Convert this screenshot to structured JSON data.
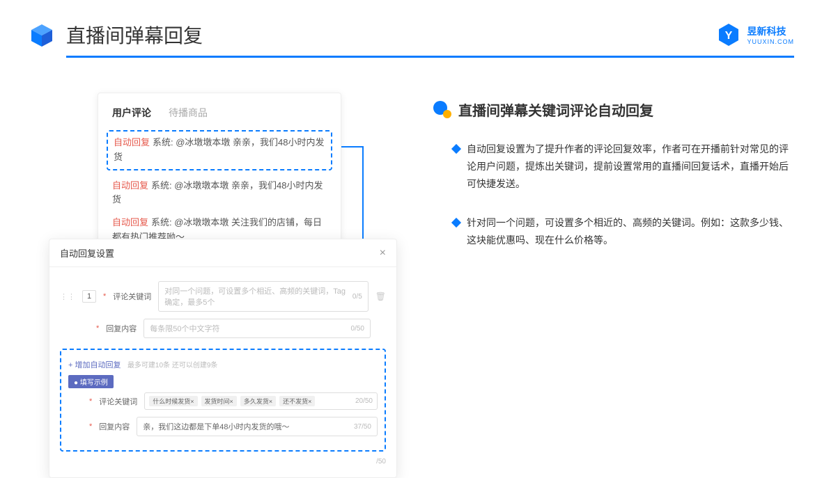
{
  "header": {
    "title": "直播间弹幕回复",
    "logo_cn": "昱新科技",
    "logo_en": "YUUXIN.COM"
  },
  "panel1": {
    "tab_active": "用户评论",
    "tab_inactive": "待播商品",
    "auto_reply_label": "自动回复",
    "comments": [
      "系统: @冰墩墩本墩 亲亲，我们48小时内发货",
      "系统: @冰墩墩本墩 亲亲，我们48小时内发货",
      "系统: @冰墩墩本墩 关注我们的店铺，每日都有热门推荐呦～"
    ]
  },
  "panel2": {
    "title": "自动回复设置",
    "row_num": "1",
    "label_keyword": "评论关键词",
    "placeholder_keyword": "对同一个问题，可设置多个相近、高频的关键词，Tag确定，最多5个",
    "counter_keyword": "0/5",
    "label_content": "回复内容",
    "placeholder_content": "每条限50个中文字符",
    "counter_content": "0/50",
    "add_link": "+ 增加自动回复",
    "add_hint": "最多可建10条 还可以创建9条",
    "example_badge": "● 填写示例",
    "ex_label_keyword": "评论关键词",
    "ex_tags": [
      "什么时候发货×",
      "发货时间×",
      "多久发货×",
      "还不发货×"
    ],
    "ex_counter_keyword": "20/50",
    "ex_label_content": "回复内容",
    "ex_content_text": "亲，我们这边都是下单48小时内发货的哦～",
    "ex_counter_content": "37/50",
    "outer_counter": "/50"
  },
  "right": {
    "section_title": "直播间弹幕关键词评论自动回复",
    "bullets": [
      "自动回复设置为了提升作者的评论回复效率，作者可在开播前针对常见的评论用户问题，提炼出关键词，提前设置常用的直播间回复话术，直播开始后可快捷发送。",
      "针对同一个问题，可设置多个相近的、高频的关键词。例如：这款多少钱、这块能优惠吗、现在什么价格等。"
    ]
  }
}
